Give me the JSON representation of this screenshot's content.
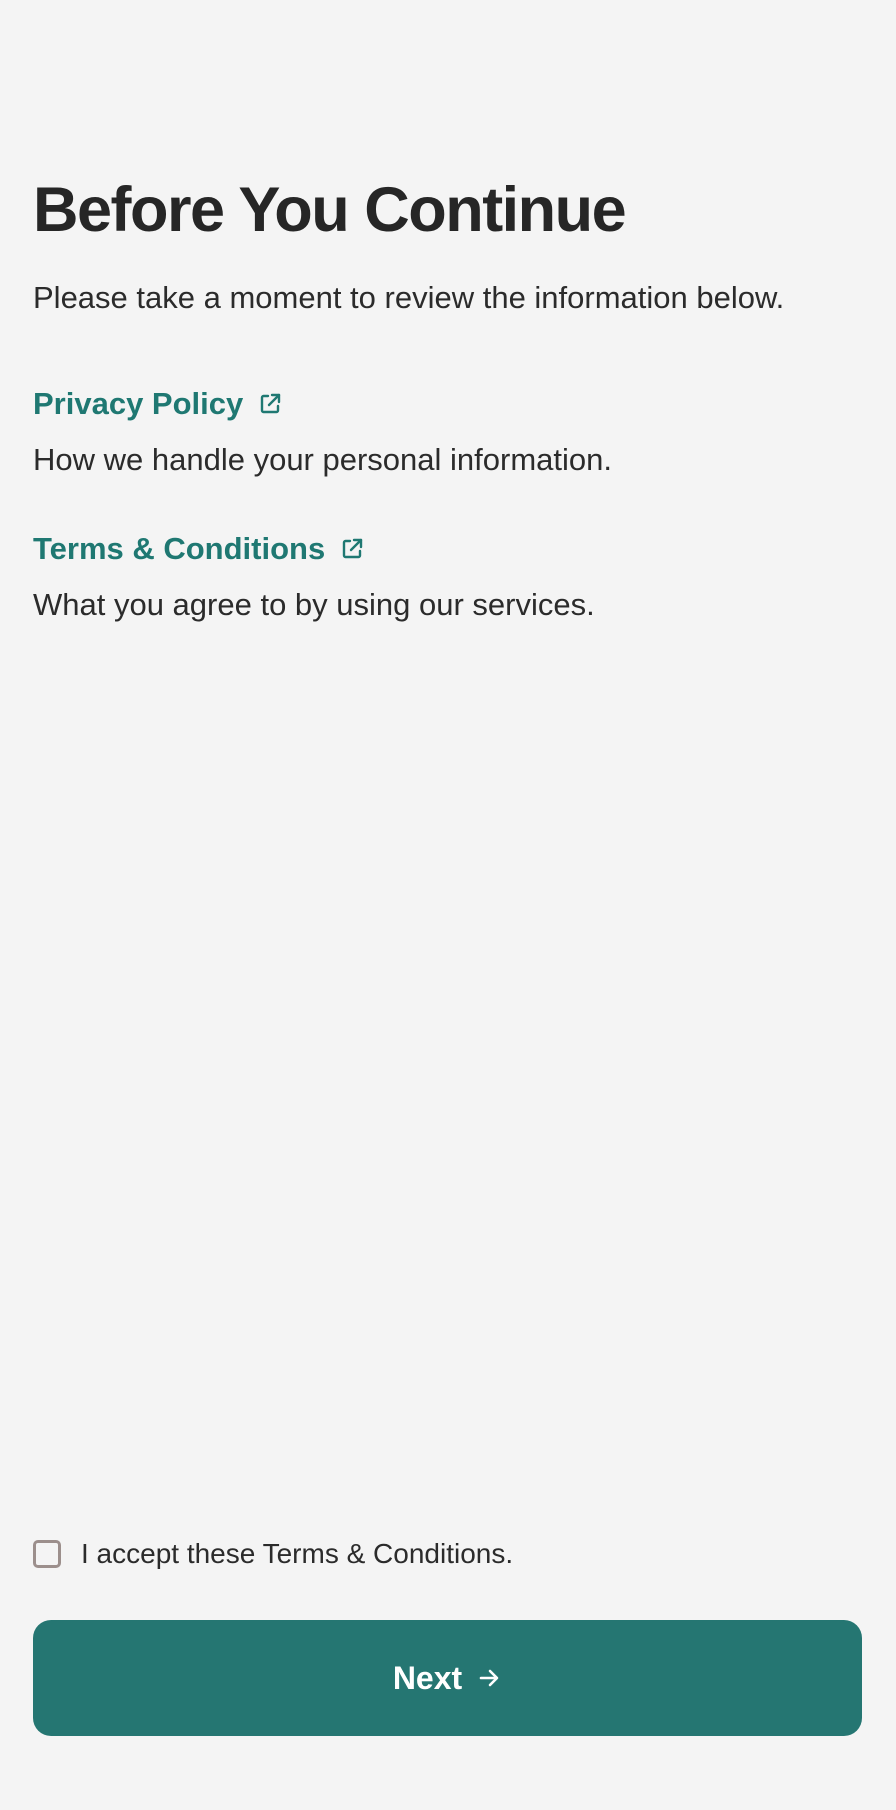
{
  "header": {
    "title": "Before You Continue",
    "subtitle": "Please take a moment to review the information below."
  },
  "links": [
    {
      "label": "Privacy Policy",
      "description": "How we handle your personal information.",
      "icon": "external-link-icon"
    },
    {
      "label": "Terms & Conditions",
      "description": "What you agree to by using our services.",
      "icon": "external-link-icon"
    }
  ],
  "consent": {
    "label": "I accept these Terms & Conditions.",
    "checked": false
  },
  "footer": {
    "next_label": "Next",
    "next_icon": "arrow-right-icon"
  },
  "colors": {
    "background": "#f4f4f4",
    "accent": "#257672",
    "link": "#1f7872",
    "text": "#2b2b2b"
  }
}
